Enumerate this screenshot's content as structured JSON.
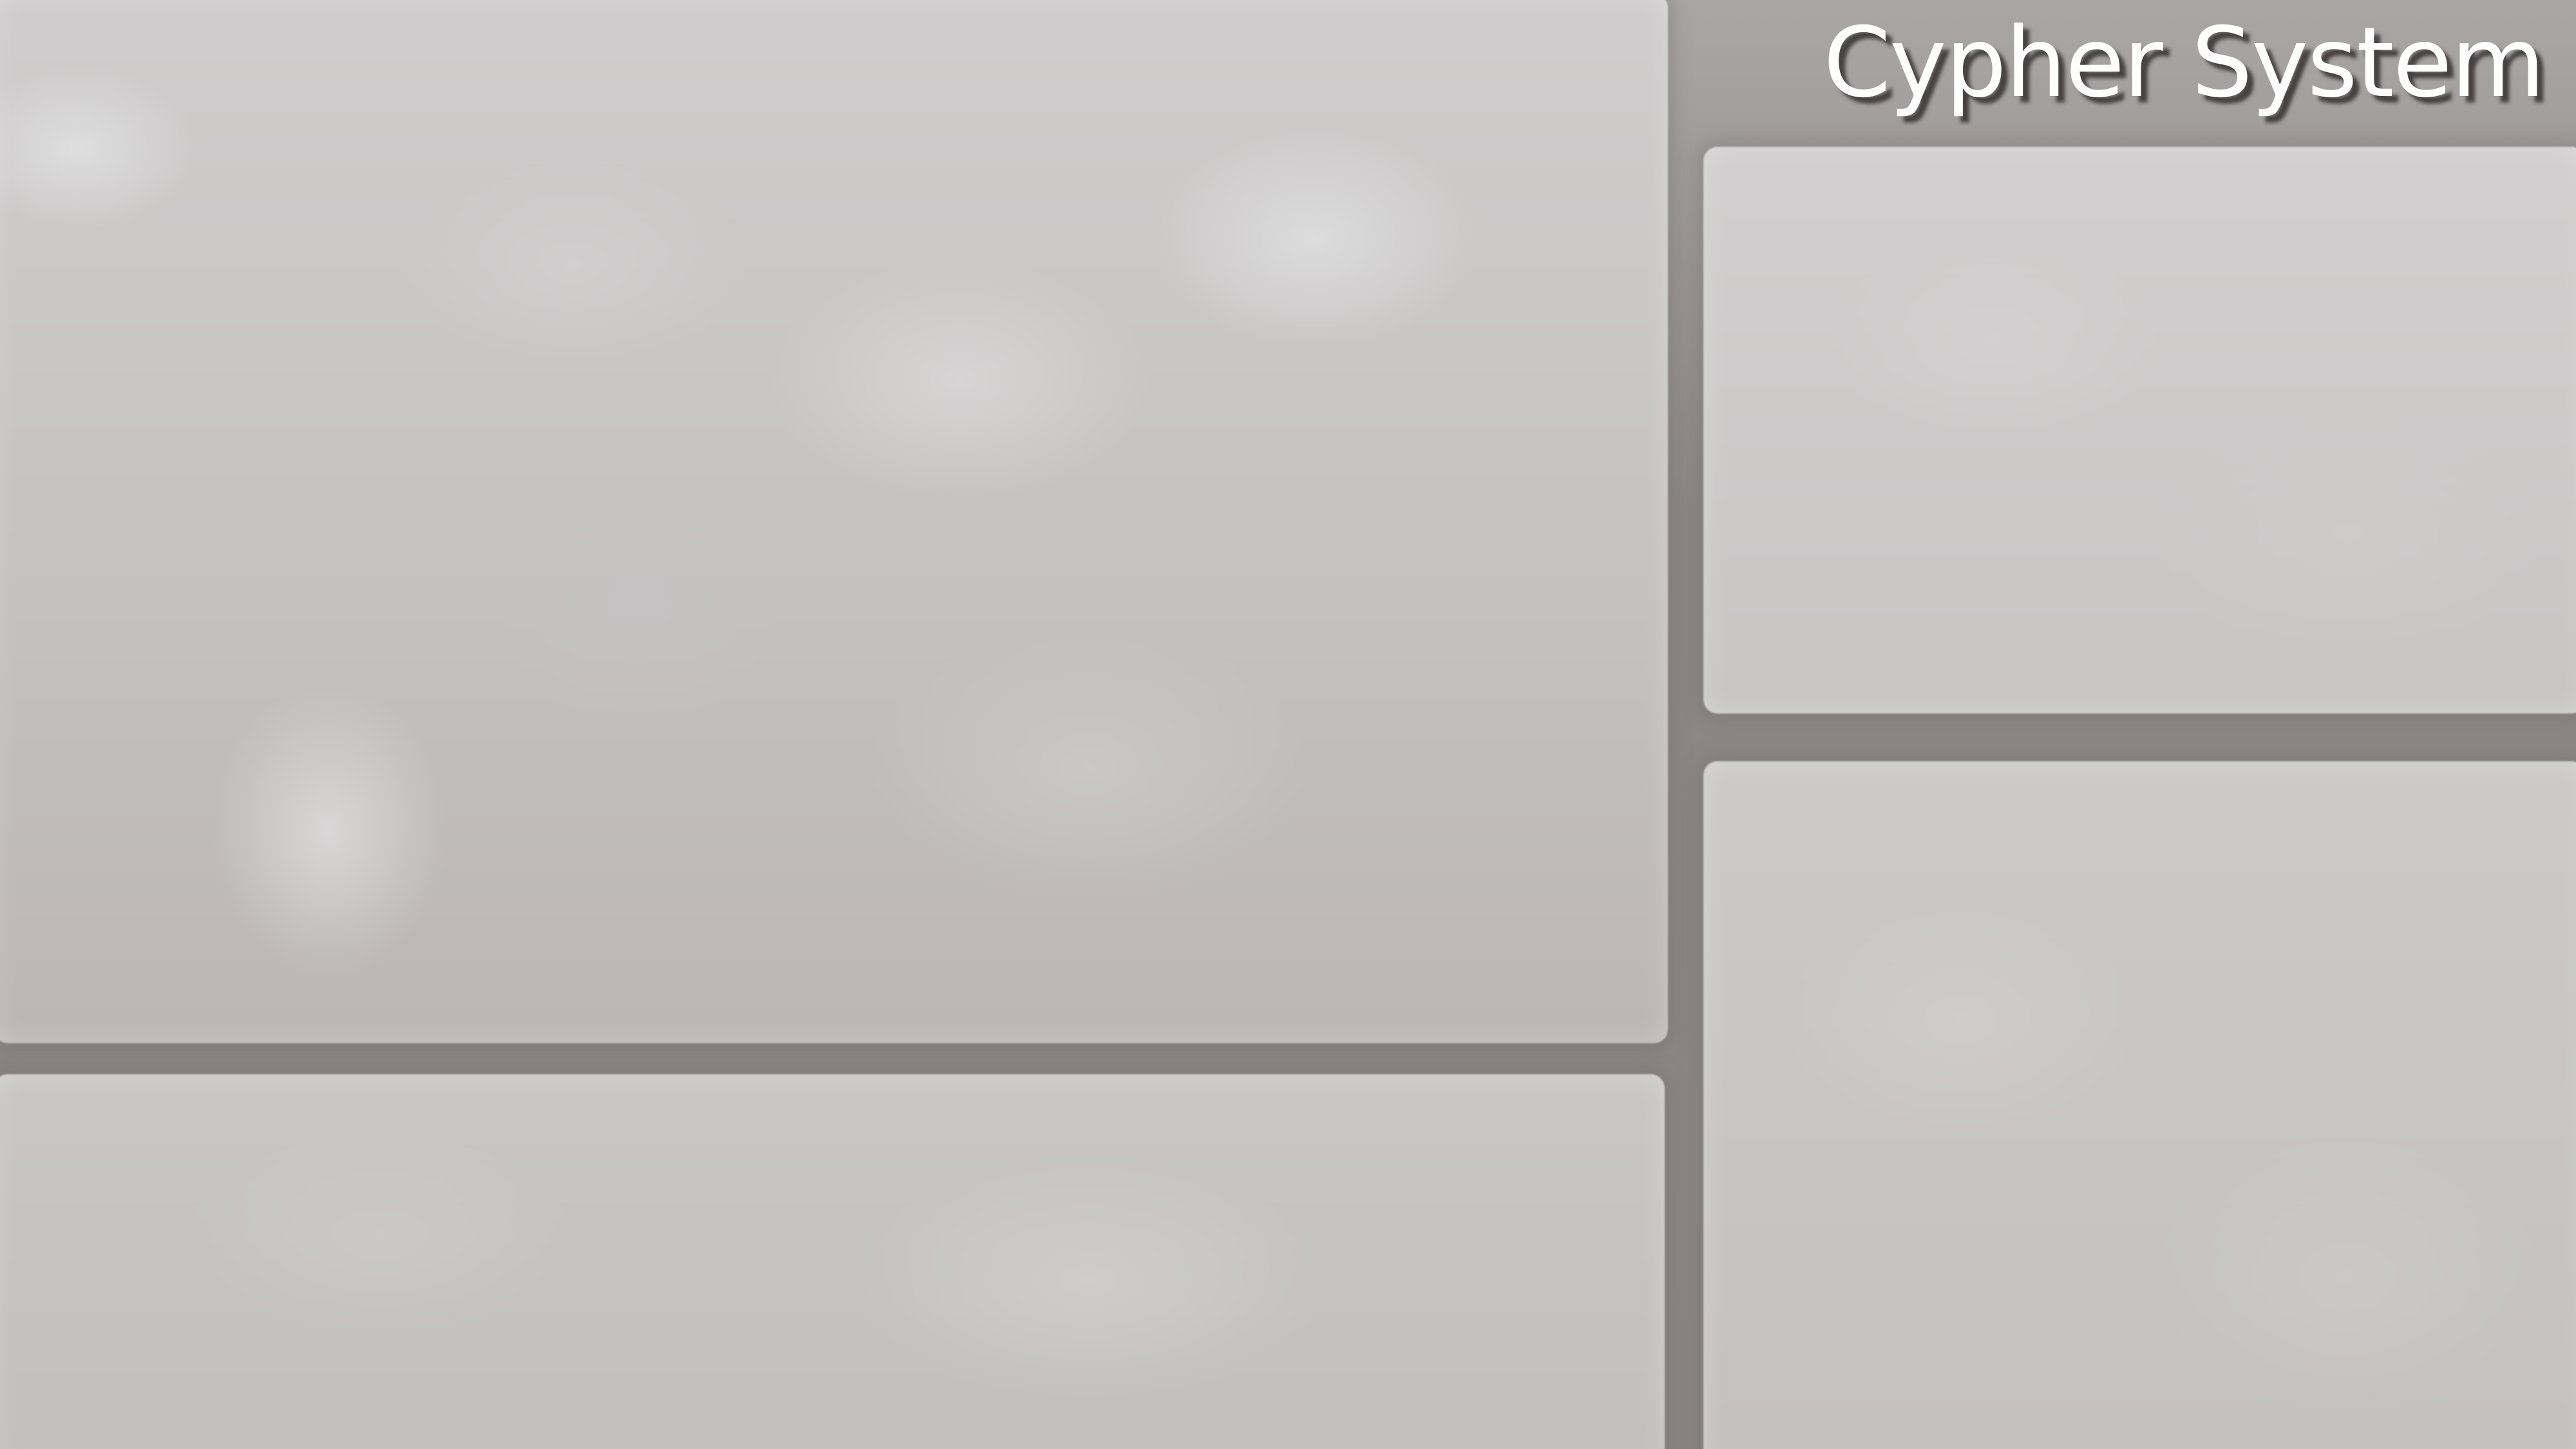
{
  "header": {
    "title": "Cypher System"
  },
  "theme": {
    "background": "#8f8a8a",
    "panel": "#c9c6c6",
    "title_color": "#ffffff"
  }
}
